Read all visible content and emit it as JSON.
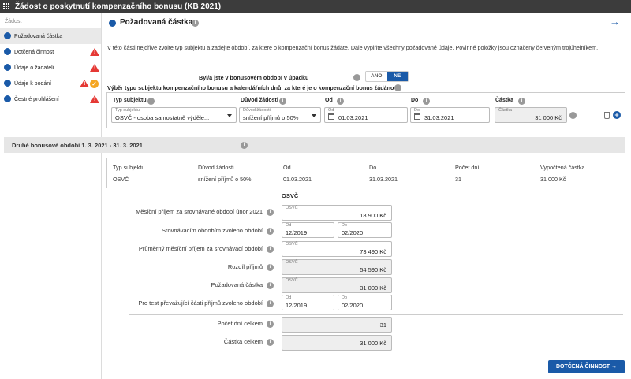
{
  "window": {
    "title": "Žádost o poskytnutí kompenzačního bonusu (KB 2021)"
  },
  "sidebar": {
    "header": "Žádost",
    "items": [
      {
        "label": "Požadovaná částka",
        "active": true,
        "warning": false,
        "done": false
      },
      {
        "label": "Dotčená činnost",
        "warning": true
      },
      {
        "label": "Údaje o žadateli",
        "warning": true
      },
      {
        "label": "Údaje k podání",
        "warning": true,
        "done": true
      },
      {
        "label": "Čestné prohlášení",
        "warning": true
      }
    ]
  },
  "section": {
    "title": "Požadovaná částka",
    "intro": "V této části nejdříve zvolte typ subjektu a zadejte období, za které o kompenzační bonus žádáte. Dále vyplňte všechny požadované údaje. Povinné položky jsou označeny červeným trojúhelníkem.",
    "decline_question": "Byl/a jste v bonusovém období v úpadku",
    "toggle": {
      "yes": "ANO",
      "no": "NE",
      "selected": "NE"
    },
    "select_title": "Výběr typu subjektu kompenzačního bonusu a kalendářních dnů, za které je o kompenzační bonus žádáno"
  },
  "entry": {
    "headers": {
      "type": "Typ subjektu",
      "reason": "Důvod žádosti",
      "from": "Od",
      "to": "Do",
      "amount": "Částka"
    },
    "small": {
      "type": "Typ subjektu",
      "reason": "Důvod žádosti",
      "from": "Od",
      "to": "Do",
      "amount": "Částka"
    },
    "type": "OSVČ - osoba samostatně výděle...",
    "reason": "snížení příjmů o 50%",
    "from": "01.03.2021",
    "to": "31.03.2021",
    "amount": "31 000 Kč"
  },
  "period": {
    "title": "Druhé bonusové období 1. 3. 2021 - 31. 3. 2021",
    "headers": {
      "type": "Typ subjektu",
      "reason": "Důvod žádosti",
      "from": "Od",
      "to": "Do",
      "days": "Počet dní",
      "calc": "Vypočtená částka"
    },
    "row": {
      "type": "OSVČ",
      "reason": "snížení příjmů o 50%",
      "from": "01.03.2021",
      "to": "31.03.2021",
      "days": "31",
      "calc": "31 000 Kč"
    }
  },
  "detail": {
    "subtitle": "OSVČ",
    "rows": {
      "monthly_income": {
        "label": "Měsíční příjem za srovnávané období únor 2021",
        "small": "OSVČ",
        "value": "18 900 Kč"
      },
      "comparison_period": {
        "label": "Srovnávacím obdobím zvoleno období",
        "from_small": "Od",
        "from": "12/2019",
        "to_small": "Do",
        "to": "02/2020"
      },
      "avg_income": {
        "label": "Průměrný měsíční příjem za srovnávací období",
        "small": "OSVČ",
        "value": "73 490 Kč"
      },
      "income_diff": {
        "label": "Rozdíl příjmů",
        "small": "OSVČ",
        "value": "54 590 Kč"
      },
      "requested": {
        "label": "Požadovaná částka",
        "small": "OSVČ",
        "value": "31 000 Kč"
      },
      "test_period": {
        "label": "Pro test převažující části příjmů zvoleno období",
        "from_small": "Od",
        "from": "12/2019",
        "to_small": "Do",
        "to": "02/2020"
      },
      "days_total": {
        "label": "Počet dní celkem",
        "value": "31"
      },
      "amount_total": {
        "label": "Částka celkem",
        "value": "31 000 Kč"
      }
    }
  },
  "footer": {
    "next_button": "DOTČENÁ ČINNOST →"
  }
}
